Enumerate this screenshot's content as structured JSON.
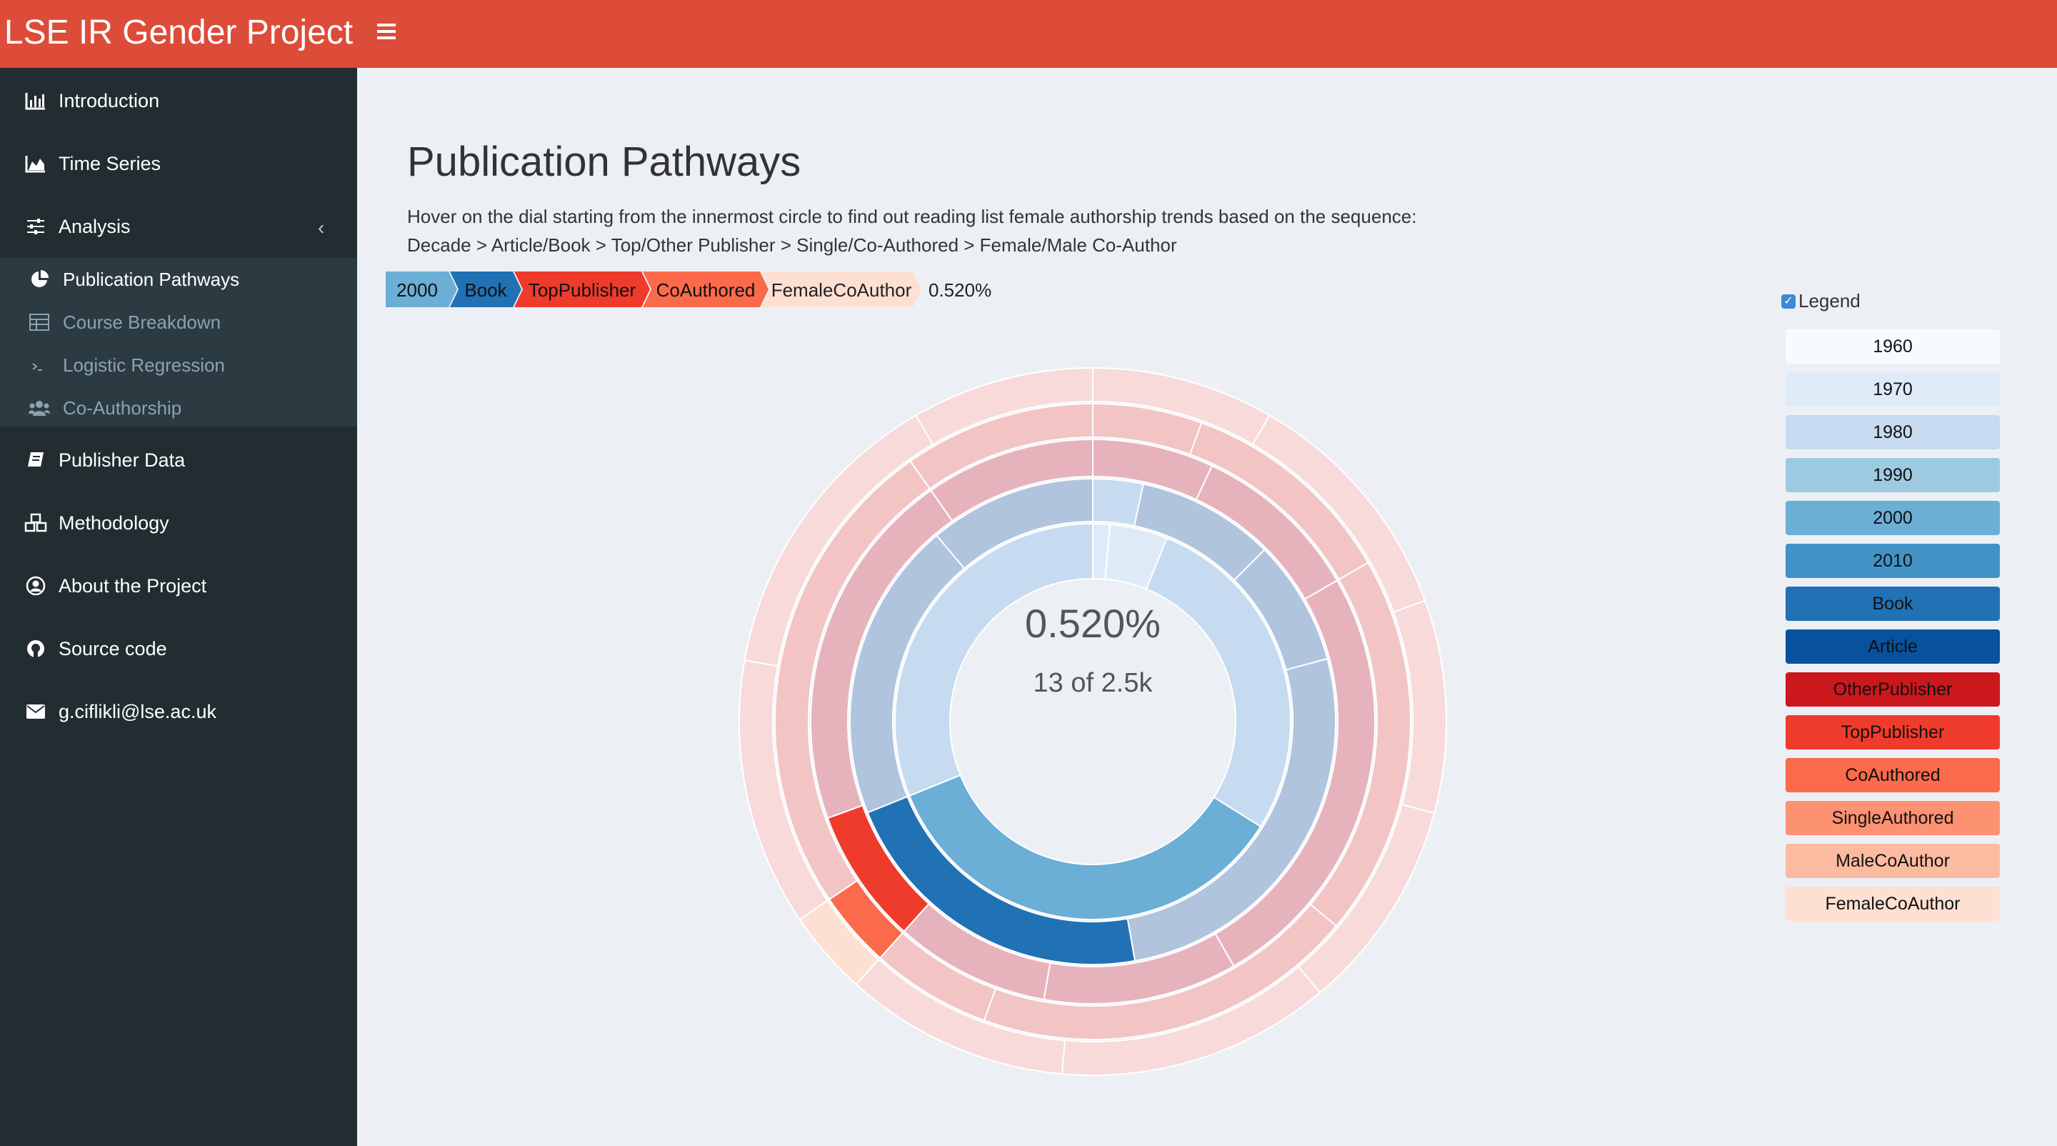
{
  "app": {
    "title": "LSE IR Gender Project"
  },
  "sidebar": {
    "items": [
      {
        "label": "Introduction",
        "icon": "bar-chart-icon"
      },
      {
        "label": "Time Series",
        "icon": "area-chart-icon"
      },
      {
        "label": "Analysis",
        "icon": "sliders-icon"
      },
      {
        "label": "Publisher Data",
        "icon": "book-icon"
      },
      {
        "label": "Methodology",
        "icon": "cubes-icon"
      },
      {
        "label": "About the Project",
        "icon": "user-circle-icon"
      },
      {
        "label": "Source code",
        "icon": "github-icon"
      },
      {
        "label": "g.ciflikli@lse.ac.uk",
        "icon": "envelope-icon"
      }
    ],
    "submenu": [
      {
        "label": "Publication Pathways",
        "icon": "pie-chart-icon",
        "active": true
      },
      {
        "label": "Course Breakdown",
        "icon": "table-icon",
        "active": false
      },
      {
        "label": "Logistic Regression",
        "icon": "terminal-icon",
        "active": false
      },
      {
        "label": "Co-Authorship",
        "icon": "users-icon",
        "active": false
      }
    ]
  },
  "main": {
    "title": "Publication Pathways",
    "description_line1": "Hover on the dial starting from the innermost circle to find out reading list female authorship trends based on the sequence:",
    "description_line2": "Decade > Article/Book > Top/Other Publisher > Single/Co-Authored > Female/Male Co-Author",
    "breadcrumb": [
      {
        "label": "2000",
        "color": "#6baed6"
      },
      {
        "label": "Book",
        "color": "#2171b5"
      },
      {
        "label": "TopPublisher",
        "color": "#ef3b2c"
      },
      {
        "label": "CoAuthored",
        "color": "#fb6a4a"
      },
      {
        "label": "FemaleCoAuthor",
        "color": "#fee0d2"
      }
    ],
    "breadcrumb_percentage": "0.520%",
    "center_percentage": "0.520%",
    "center_count": "13 of 2.5k"
  },
  "legend": {
    "label": "Legend",
    "checked": true,
    "items": [
      {
        "label": "1960",
        "color": "#f7fbff"
      },
      {
        "label": "1970",
        "color": "#deebf7"
      },
      {
        "label": "1980",
        "color": "#c6dbef"
      },
      {
        "label": "1990",
        "color": "#9ecae1"
      },
      {
        "label": "2000",
        "color": "#6baed6"
      },
      {
        "label": "2010",
        "color": "#4292c6"
      },
      {
        "label": "Book",
        "color": "#2171b5"
      },
      {
        "label": "Article",
        "color": "#08519c"
      },
      {
        "label": "OtherPublisher",
        "color": "#cb181d"
      },
      {
        "label": "TopPublisher",
        "color": "#ef3b2c"
      },
      {
        "label": "CoAuthored",
        "color": "#fb6a4a"
      },
      {
        "label": "SingleAuthored",
        "color": "#fc9272"
      },
      {
        "label": "MaleCoAuthor",
        "color": "#fcbba1"
      },
      {
        "label": "FemaleCoAuthor",
        "color": "#fee0d2"
      }
    ]
  }
}
